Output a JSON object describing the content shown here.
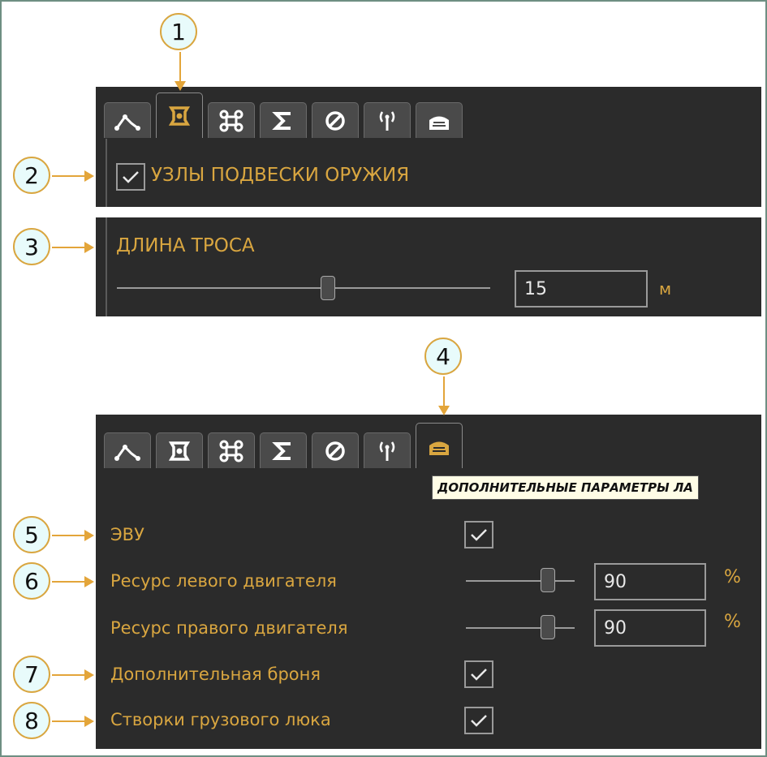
{
  "callouts": [
    "1",
    "2",
    "3",
    "4",
    "5",
    "6",
    "7",
    "8"
  ],
  "tabs": {
    "icons": [
      "waypoints-icon",
      "weapon-pylon-icon",
      "drone-icon",
      "sigma-icon",
      "no-entry-icon",
      "antenna-icon",
      "aircraft-hatch-icon"
    ]
  },
  "panel_top": {
    "checkbox_label": "УЗЛЫ ПОДВЕСКИ ОРУЖИЯ",
    "checked": true
  },
  "panel_rope": {
    "label": "ДЛИНА ТРОСА",
    "value": "15",
    "unit": "м",
    "slider_fraction": 0.57
  },
  "panel_bottom": {
    "tooltip": "ДОПОЛНИТЕЛЬНЫЕ ПАРАМЕТРЫ ЛА",
    "evu_label": "ЭВУ",
    "left_engine_label": "Ресурс левого двигателя",
    "left_engine_value": "90",
    "right_engine_label": "Ресурс правого двигателя",
    "right_engine_value": "90",
    "percent_unit": "%",
    "engine_slider_fraction": 0.75,
    "armor_label": "Дополнительная броня",
    "cargo_doors_label": "Створки грузового люка"
  },
  "colors": {
    "accent": "#d9a640",
    "panel_bg": "#2b2b2b",
    "callout_fill": "#e8fbfb",
    "arrow": "#e3a53a"
  }
}
